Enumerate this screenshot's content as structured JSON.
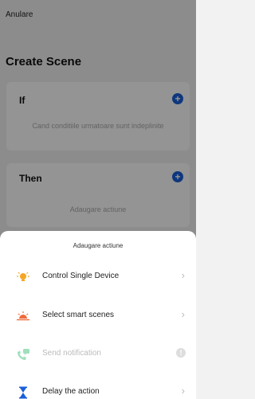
{
  "header": {
    "cancel_label": "Anulare",
    "title": "Create Scene"
  },
  "if_section": {
    "title": "If",
    "hint": "Cand conditiile urmatoare sunt indeplinite",
    "add_symbol": "+"
  },
  "then_section": {
    "title": "Then",
    "hint": "Adaugare actiune",
    "add_symbol": "+"
  },
  "sheet": {
    "title": "Adaugare actiune",
    "items": [
      {
        "label": "Control Single Device",
        "icon": "lightbulb-icon",
        "enabled": true
      },
      {
        "label": "Select smart scenes",
        "icon": "sunset-icon",
        "enabled": true
      },
      {
        "label": "Send notification",
        "icon": "notification-icon",
        "enabled": false,
        "info_symbol": "!"
      },
      {
        "label": "Delay the action",
        "icon": "hourglass-icon",
        "enabled": true
      }
    ],
    "chevron": "›"
  },
  "colors": {
    "accent": "#1a5fd8",
    "orange": "#f5a623",
    "green": "#2fbf71"
  }
}
